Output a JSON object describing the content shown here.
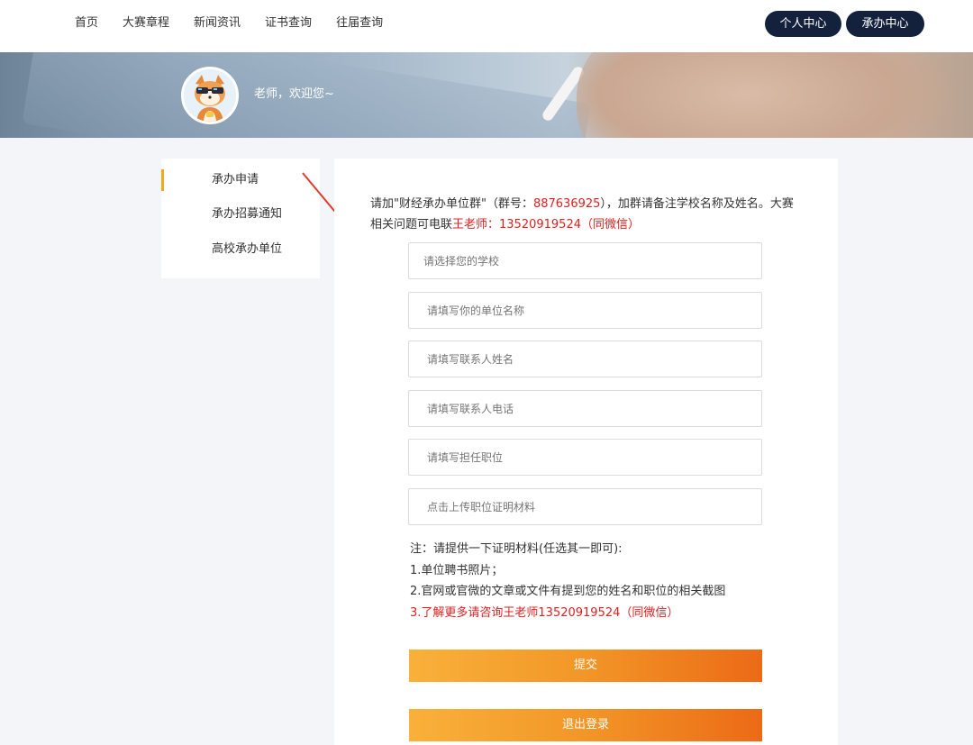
{
  "nav": {
    "items": [
      "首页",
      "大赛章程",
      "新闻资讯",
      "证书查询",
      "往届查询"
    ],
    "personal_center": "个人中心",
    "host_center": "承办中心"
  },
  "banner": {
    "welcome": "老师，欢迎您~"
  },
  "sidebar": {
    "items": [
      {
        "label": "承办申请",
        "active": true
      },
      {
        "label": "承办招募通知",
        "active": false
      },
      {
        "label": "高校承办单位",
        "active": false
      }
    ]
  },
  "form": {
    "notice_part1": "请加\"财经承办单位群\"（群号：",
    "notice_group_number": "887636925",
    "notice_part2": "），加群请备注学校名称及姓名。大赛相关问题可电联",
    "notice_contact": "王老师：13520919524（同微信）",
    "fields": [
      {
        "placeholder": "请选择您的学校"
      },
      {
        "placeholder": "请填写你的单位名称"
      },
      {
        "placeholder": "请填写联系人姓名"
      },
      {
        "placeholder": "请填写联系人电话"
      },
      {
        "placeholder": "请填写担任职位"
      },
      {
        "placeholder": "点击上传职位证明材料"
      }
    ],
    "notes": {
      "line1": "注：请提供一下证明材料(任选其一即可):",
      "line2": "1.单位聘书照片；",
      "line3": "2.官网或官微的文章或文件有提到您的姓名和职位的相关截图",
      "line4": "3.了解更多请咨询王老师13520919524（同微信）"
    },
    "submit_label": "提交",
    "logout_label": "退出登录"
  },
  "colors": {
    "nav_pill": "#14213d",
    "accent": "#f5a623",
    "highlight_red": "#e02020",
    "button_start": "#f9b13a",
    "button_end": "#ec6a16"
  }
}
